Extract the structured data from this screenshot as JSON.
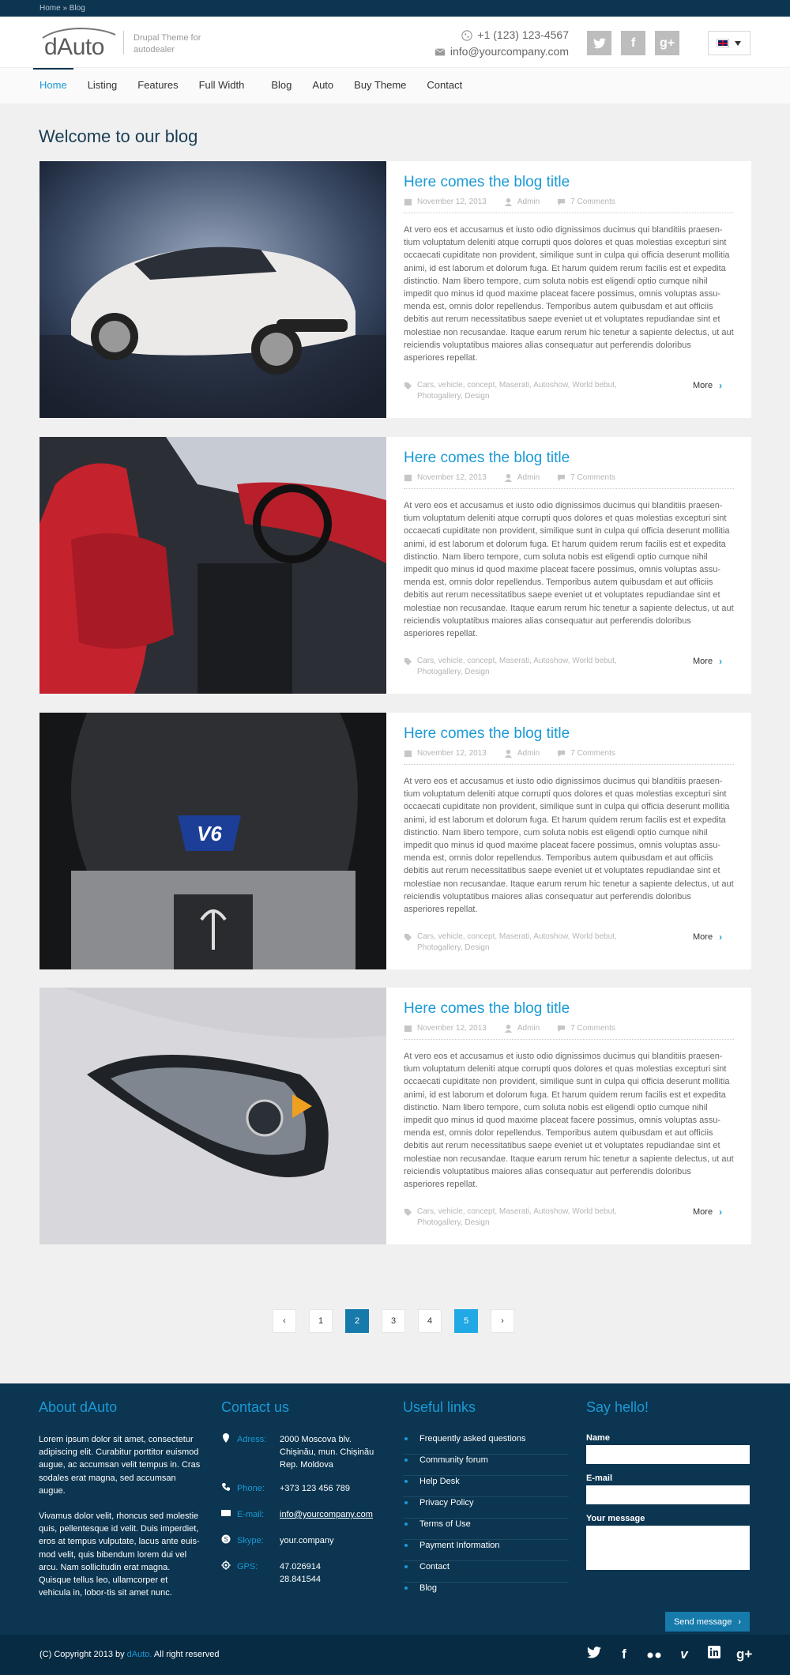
{
  "breadcrumb": "Home » Blog",
  "header": {
    "logo": "dAuto",
    "tagline": "Drupal Theme for autodealer",
    "phone": "+1 (123) 123-4567",
    "email": "info@yourcompany.com"
  },
  "nav": [
    "Home",
    "Listing",
    "Features",
    "Full Width",
    "Blog",
    "Auto",
    "Buy Theme",
    "Contact"
  ],
  "page_title": "Welcome to our blog",
  "posts": [
    {
      "title": "Here comes the blog title",
      "date": "November 12, 2013",
      "author": "Admin",
      "comments": "7 Comments",
      "tags": "Cars, vehicle, concept, Maserati, Autoshow, World bebut, Photogallery,  Design",
      "more": "More"
    },
    {
      "title": "Here comes the blog title",
      "date": "November 12, 2013",
      "author": "Admin",
      "comments": "7 Comments",
      "tags": "Cars, vehicle, concept, Maserati, Autoshow, World bebut, Photogallery,  Design",
      "more": "More"
    },
    {
      "title": "Here comes the blog title",
      "date": "November 12, 2013",
      "author": "Admin",
      "comments": "7 Comments",
      "tags": "Cars, vehicle, concept, Maserati, Autoshow, World bebut, Photogallery,  Design",
      "more": "More"
    },
    {
      "title": "Here comes the blog title",
      "date": "November 12, 2013",
      "author": "Admin",
      "comments": "7 Comments",
      "tags": "Cars, vehicle, concept, Maserati, Autoshow, World bebut, Photogallery,  Design",
      "more": "More"
    }
  ],
  "excerpt": "At vero eos et accusamus et iusto odio dignissimos ducimus qui blanditiis praesen-tium voluptatum deleniti atque corrupti quos dolores et quas molestias excepturi sint occaecati cupiditate non provident, similique sunt in culpa qui officia deserunt mollitia animi, id est laborum et dolorum fuga. Et harum quidem rerum facilis est et expedita distinctio. Nam libero tempore, cum soluta nobis est eligendi optio cumque nihil impedit quo minus id quod maxime placeat facere possimus, omnis voluptas assu-menda est, omnis dolor repellendus. Temporibus autem quibusdam et aut officiis debitis aut rerum necessitatibus saepe eveniet ut et voluptates repudiandae sint et molestiae non recusandae. Itaque earum rerum hic tenetur a sapiente delectus, ut aut reiciendis voluptatibus maiores alias consequatur aut perferendis doloribus asperiores repellat.",
  "pager": {
    "prev": "‹",
    "pages": [
      "1",
      "2",
      "3",
      "4",
      "5"
    ],
    "current": "2",
    "hover": "5",
    "next": "›"
  },
  "footer": {
    "about": {
      "title": "About dAuto",
      "p1": "Lorem ipsum dolor sit amet, consectetur adipiscing elit. Curabitur porttitor euismod augue, ac accumsan velit tempus in. Cras sodales erat magna, sed accumsan augue.",
      "p2": "Vivamus dolor velit, rhoncus sed molestie quis, pellentesque id velit. Duis imperdiet, eros at tempus vulputate, lacus ante euis-mod velit, quis bibendum lorem dui vel arcu. Nam sollicitudin erat magna. Quisque tellus leo, ullamcorper et vehicula in, lobor-tis sit amet nunc."
    },
    "contact": {
      "title": "Contact us",
      "rows": [
        {
          "label": "Adress:",
          "value": "2000 Moscova blv. Chișinău, mun. Chișinău Rep. Moldova"
        },
        {
          "label": "Phone:",
          "value": "+373 123 456 789"
        },
        {
          "label": "E-mail:",
          "value": "info@yourcompany.com"
        },
        {
          "label": "Skype:",
          "value": "your.company"
        },
        {
          "label": "GPS:",
          "value": "47.026914 28.841544"
        }
      ]
    },
    "links": {
      "title": "Useful links",
      "items": [
        "Frequently asked questions",
        "Community forum",
        "Help Desk",
        "Privacy Policy",
        "Terms of Use",
        "Payment Information",
        "Contact",
        "Blog"
      ]
    },
    "hello": {
      "title": "Say hello!",
      "name_label": "Name",
      "email_label": "E-mail",
      "message_label": "Your message",
      "send": "Send  message"
    },
    "copyright_pre": "(C) Copyright 2013 by ",
    "copyright_brand": "dAuto.",
    "copyright_post": " All right reserved"
  },
  "colors": {
    "accent": "#1a9ad6",
    "navy": "#0b3550",
    "page": "#f0f0f0"
  }
}
